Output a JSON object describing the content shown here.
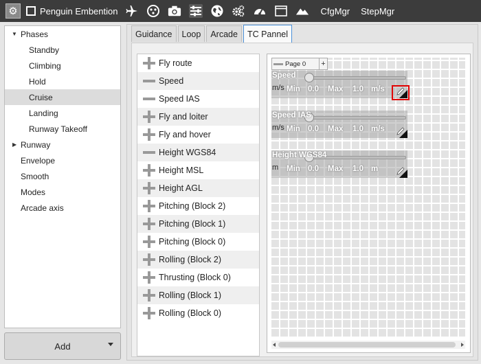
{
  "toolbar": {
    "title": "Penguin Embention",
    "cfg_label": "CfgMgr",
    "step_label": "StepMgr",
    "icons": [
      "gear-icon",
      "external-link-icon",
      "airplane-icon",
      "dots-icon",
      "camera-icon",
      "sliders-icon",
      "globe-icon",
      "cogs-icon",
      "gauge-icon",
      "window-icon",
      "mountain-icon"
    ]
  },
  "tree": {
    "items": [
      {
        "label": "Phases",
        "expanded": true
      },
      {
        "label": "Standby"
      },
      {
        "label": "Climbing"
      },
      {
        "label": "Hold"
      },
      {
        "label": "Cruise",
        "selected": true
      },
      {
        "label": "Landing"
      },
      {
        "label": "Runway Takeoff"
      },
      {
        "label": "Runway",
        "expanded": false
      },
      {
        "label": "Envelope"
      },
      {
        "label": "Smooth"
      },
      {
        "label": "Modes"
      },
      {
        "label": "Arcade axis"
      }
    ]
  },
  "add_button": {
    "label": "Add"
  },
  "tabs": [
    {
      "label": "Guidance"
    },
    {
      "label": "Loop"
    },
    {
      "label": "Arcade"
    },
    {
      "label": "TC Pannel",
      "active": true
    }
  ],
  "variables": [
    {
      "label": "Fly route",
      "icon": "plus-icon"
    },
    {
      "label": "Speed",
      "icon": "minus-icon"
    },
    {
      "label": "Speed IAS",
      "icon": "minus-icon"
    },
    {
      "label": "Fly and loiter",
      "icon": "plus-icon"
    },
    {
      "label": "Fly and hover",
      "icon": "plus-icon"
    },
    {
      "label": "Height WGS84",
      "icon": "minus-icon"
    },
    {
      "label": "Height MSL",
      "icon": "plus-icon"
    },
    {
      "label": "Height AGL",
      "icon": "plus-icon"
    },
    {
      "label": "Pitching (Block 2)",
      "icon": "plus-icon"
    },
    {
      "label": "Pitching (Block 1)",
      "icon": "plus-icon"
    },
    {
      "label": "Pitching (Block 0)",
      "icon": "plus-icon"
    },
    {
      "label": "Rolling (Block 2)",
      "icon": "plus-icon"
    },
    {
      "label": "Thrusting (Block 0)",
      "icon": "plus-icon"
    },
    {
      "label": "Rolling (Block 1)",
      "icon": "plus-icon"
    },
    {
      "label": "Rolling (Block 0)",
      "icon": "plus-icon"
    }
  ],
  "page": {
    "label": "Page 0",
    "add": "+"
  },
  "widgets": [
    {
      "name": "Speed",
      "unit": "m/s",
      "min_label": "Min",
      "min": "0.0",
      "max_label": "Max",
      "max": "1.0",
      "unit2": "m/s"
    },
    {
      "name": "Speed IAS",
      "unit": "m/s",
      "min_label": "Min",
      "min": "0.0",
      "max_label": "Max",
      "max": "1.0",
      "unit2": "m/s"
    },
    {
      "name": "Height WGS84",
      "unit": "m",
      "min_label": "Min",
      "min": "0.0",
      "max_label": "Max",
      "max": "1.0",
      "unit2": "m"
    }
  ],
  "colors": {
    "toolbar_bg": "#3c3c3c",
    "selected_row": "#dcdcdc",
    "highlight": "#e00000",
    "tab_active_border": "#4a90d9"
  }
}
